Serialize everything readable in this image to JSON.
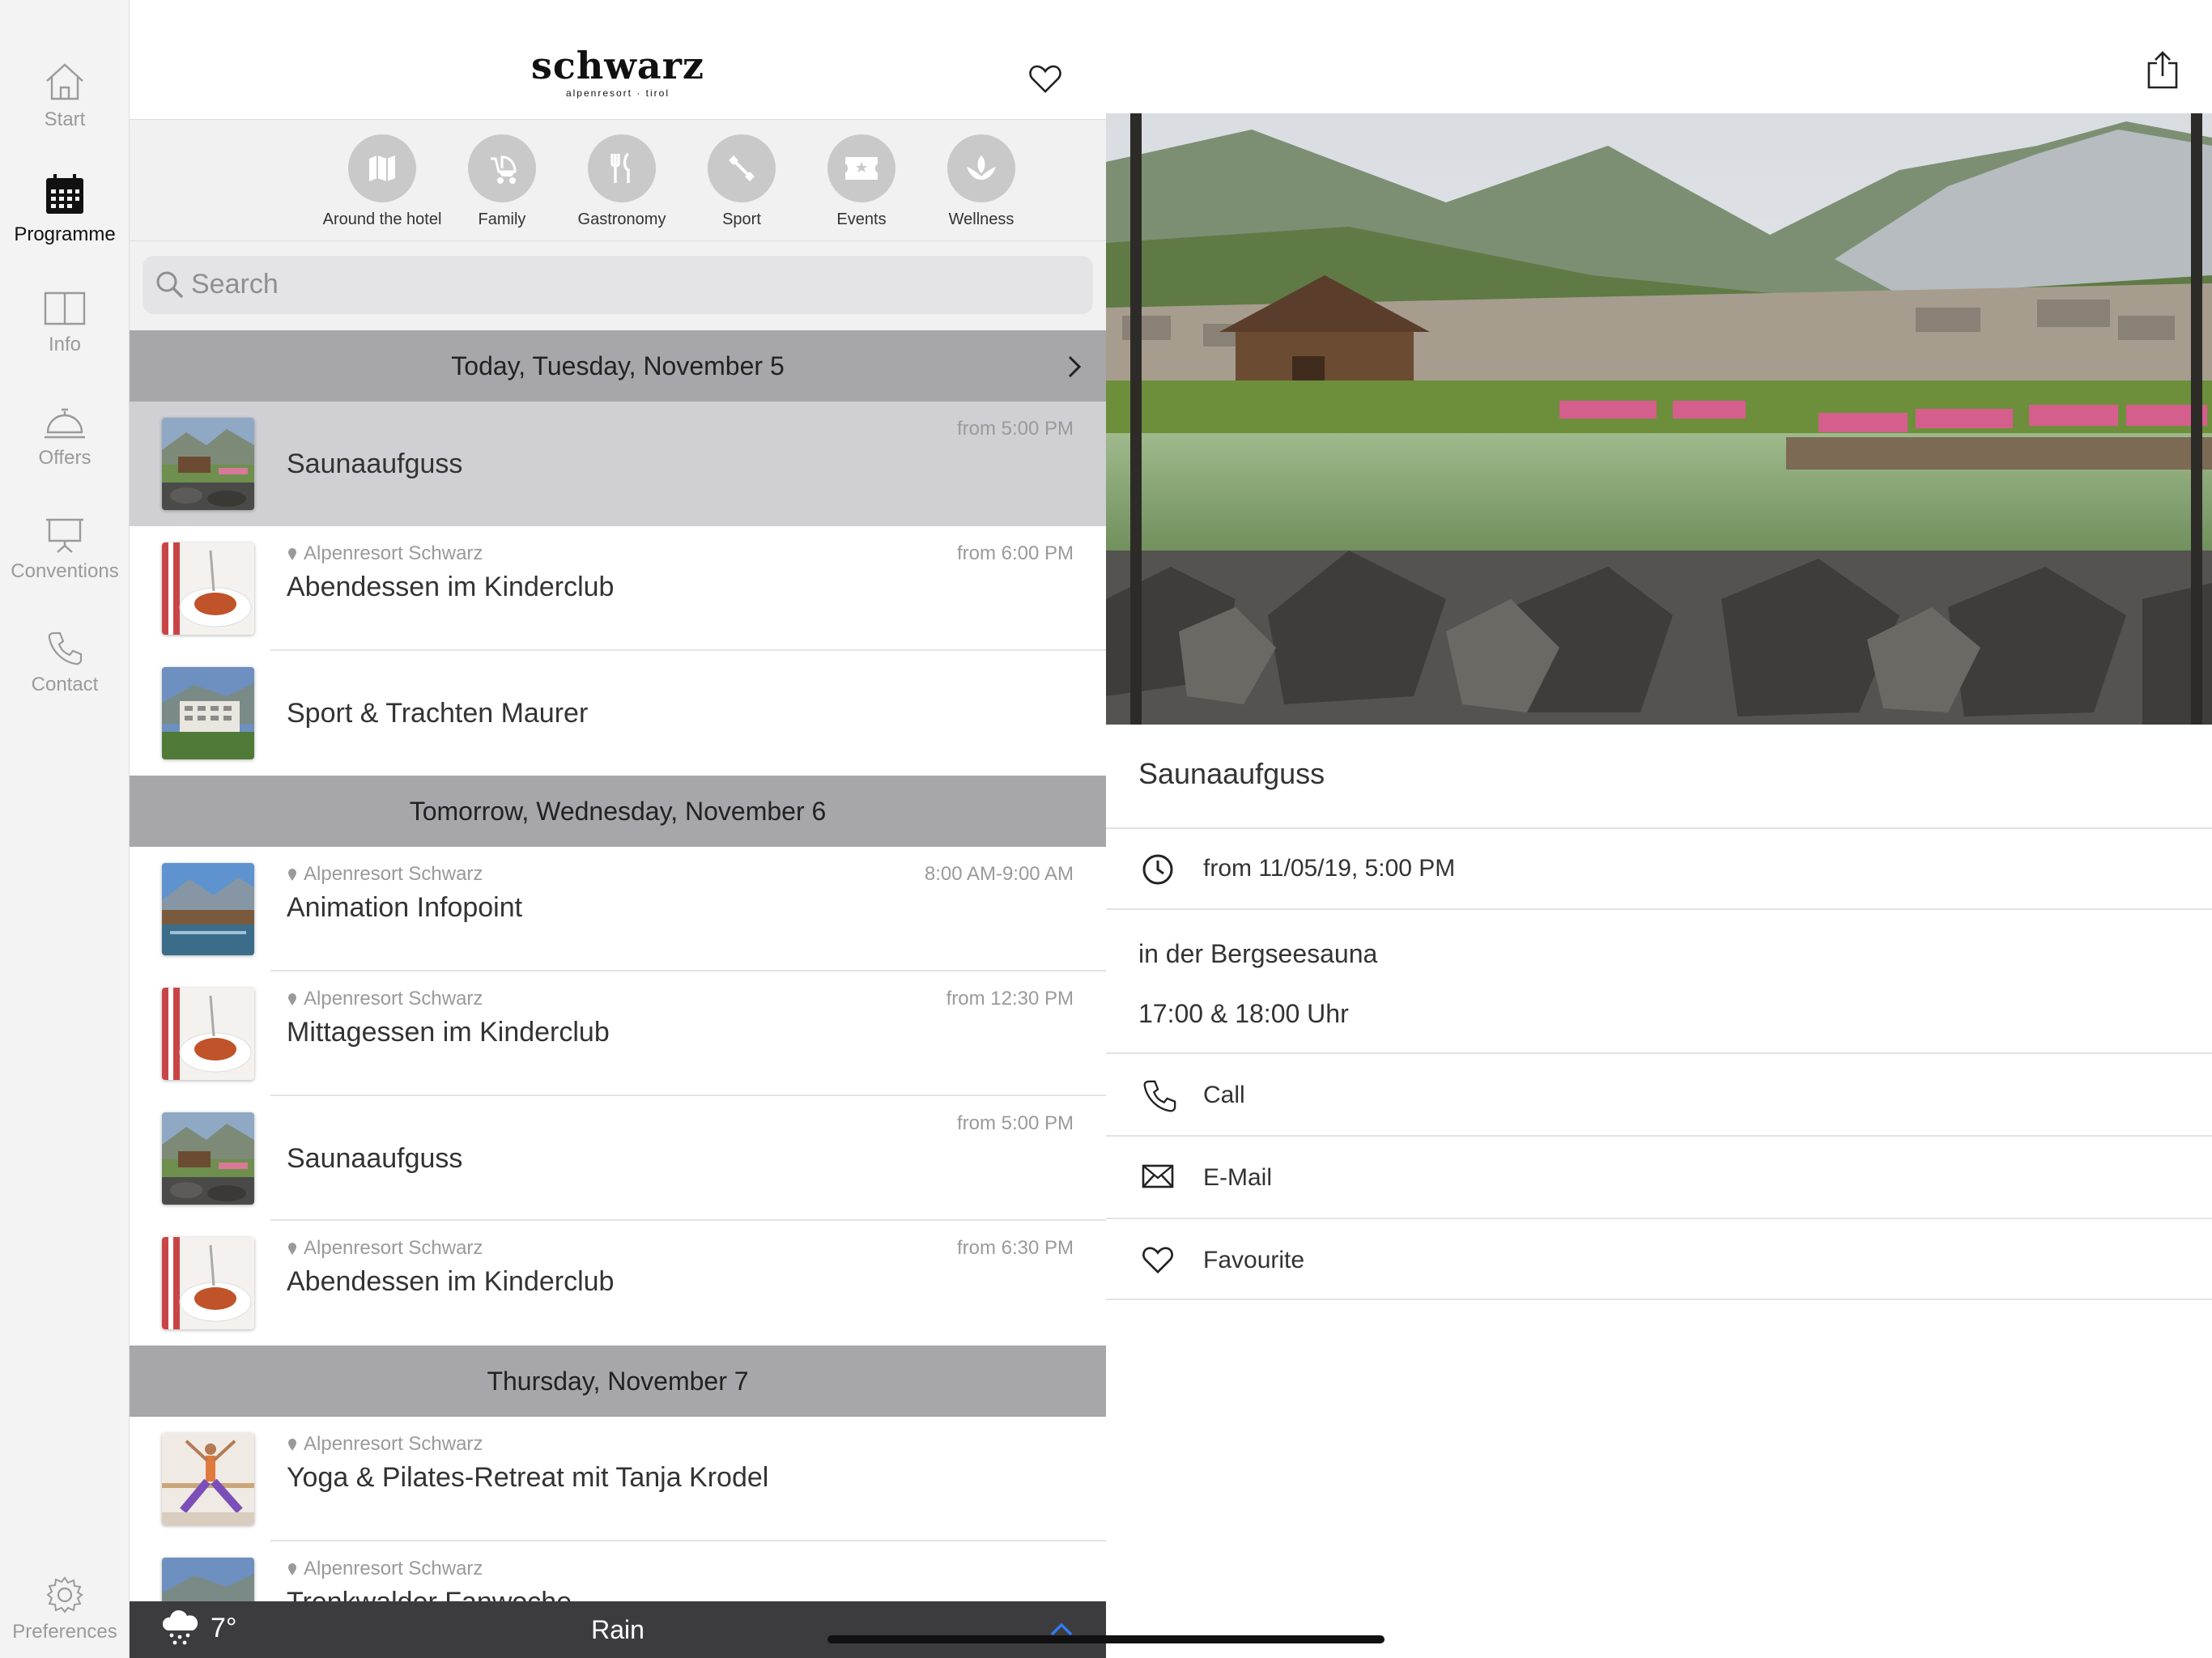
{
  "nav": {
    "items": [
      {
        "label": "Start",
        "icon": "home-icon"
      },
      {
        "label": "Programme",
        "icon": "calendar-icon",
        "active": true
      },
      {
        "label": "Info",
        "icon": "book-icon"
      },
      {
        "label": "Offers",
        "icon": "bell-icon"
      },
      {
        "label": "Conventions",
        "icon": "presentation-icon"
      },
      {
        "label": "Contact",
        "icon": "phone-icon"
      }
    ],
    "preferences": "Preferences"
  },
  "header": {
    "brand": "schwarz",
    "brand_sub": "alpenresort · tirol"
  },
  "categories": [
    {
      "label": "Around the hotel",
      "icon": "map-icon"
    },
    {
      "label": "Family",
      "icon": "stroller-icon"
    },
    {
      "label": "Gastronomy",
      "icon": "cutlery-icon"
    },
    {
      "label": "Sport",
      "icon": "dumbbell-icon"
    },
    {
      "label": "Events",
      "icon": "ticket-icon"
    },
    {
      "label": "Wellness",
      "icon": "lotus-icon"
    }
  ],
  "search": {
    "placeholder": "Search"
  },
  "days": [
    {
      "label": "Today, Tuesday, November 5"
    },
    {
      "label": "Tomorrow, Wednesday, November 6"
    },
    {
      "label": "Thursday, November 7"
    }
  ],
  "events": [
    {
      "title": "Saunaaufguss",
      "location": "",
      "time": "from 5:00 PM",
      "selected": true
    },
    {
      "title": "Abendessen im Kinderclub",
      "location": "Alpenresort Schwarz",
      "time": "from 6:00 PM"
    },
    {
      "title": "Sport & Trachten Maurer",
      "location": "",
      "time": ""
    },
    {
      "title": "Animation Infopoint",
      "location": "Alpenresort Schwarz",
      "time": "8:00 AM-9:00 AM"
    },
    {
      "title": "Mittagessen im Kinderclub",
      "location": "Alpenresort Schwarz",
      "time": "from 12:30 PM"
    },
    {
      "title": "Saunaaufguss",
      "location": "",
      "time": "from 5:00 PM"
    },
    {
      "title": "Abendessen im Kinderclub",
      "location": "Alpenresort Schwarz",
      "time": "from 6:30 PM"
    },
    {
      "title": "Yoga & Pilates-Retreat mit Tanja Krodel",
      "location": "Alpenresort Schwarz",
      "time": ""
    },
    {
      "title": "Trenkwalder Fanwoche",
      "location": "Alpenresort Schwarz",
      "time": ""
    }
  ],
  "weather": {
    "temp": "7°",
    "condition": "Rain"
  },
  "detail": {
    "title": "Saunaaufguss",
    "datetime": "from 11/05/19, 5:00 PM",
    "desc_line1": "in der Bergseesauna",
    "desc_line2": "17:00 & 18:00 Uhr",
    "call": "Call",
    "email": "E-Mail",
    "favourite": "Favourite"
  },
  "colors": {
    "day_header": "#a7a7ab",
    "selected_row": "#d0d0d4",
    "rail_bg": "#f3f3f3",
    "weather_bar": "#3c3c3e",
    "accent_blue": "#2f7bf5"
  }
}
